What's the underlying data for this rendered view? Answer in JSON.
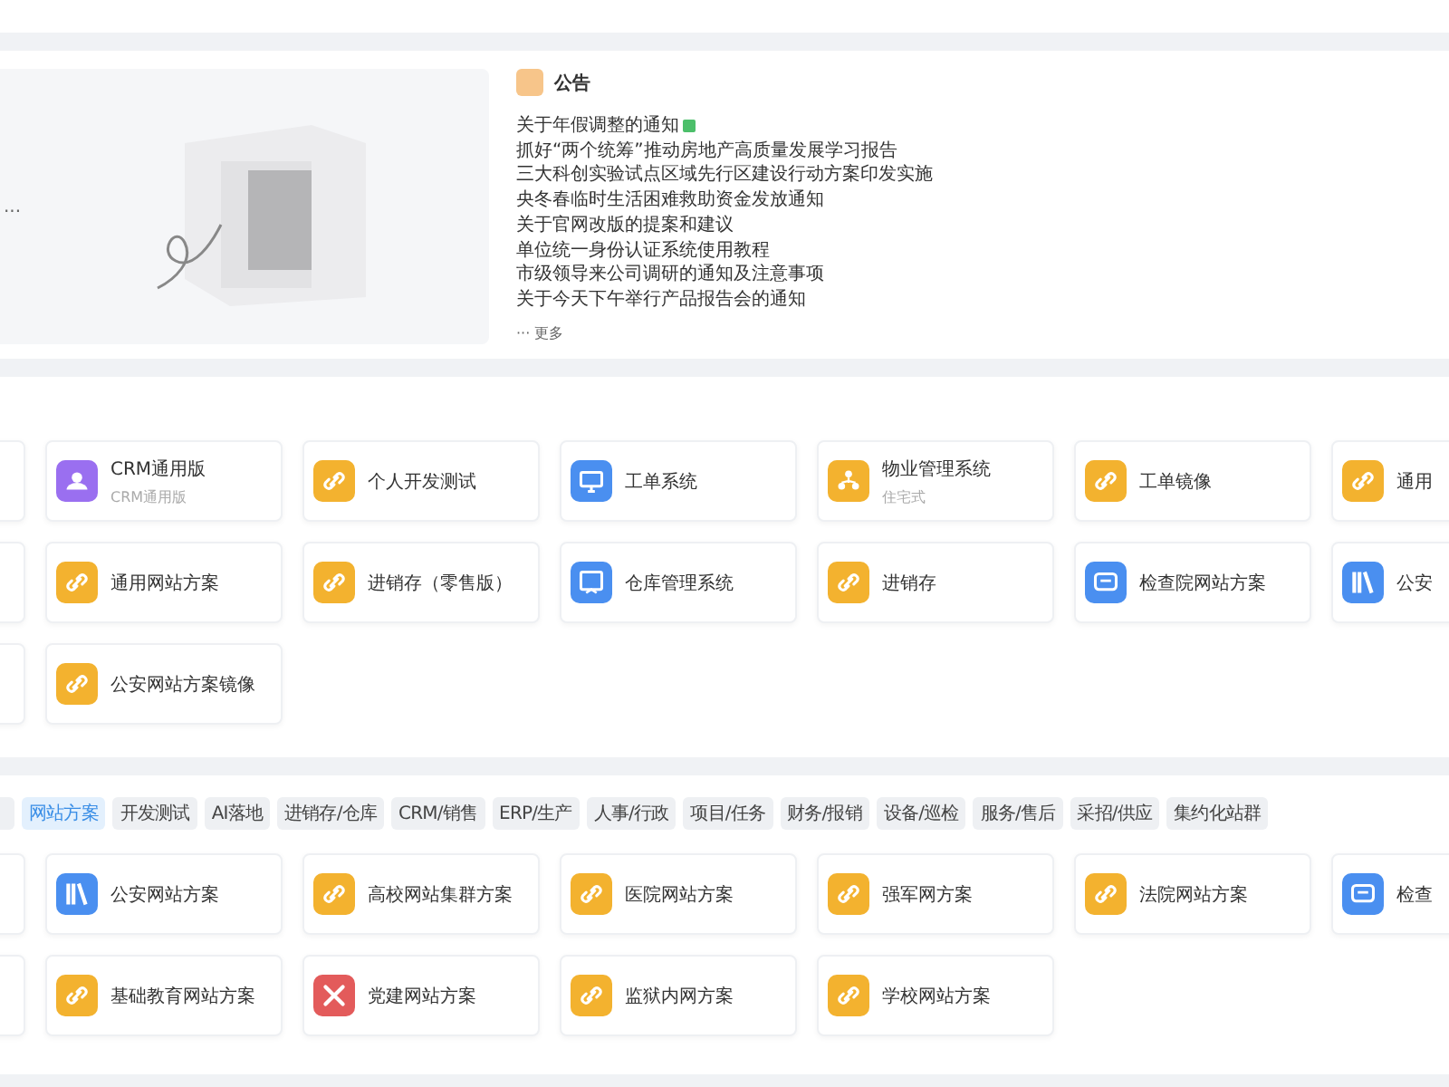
{
  "banner": {
    "hint": "..."
  },
  "notice": {
    "title": "公告",
    "items": [
      {
        "text": "关于年假调整的通知",
        "new": true
      },
      {
        "text": "抓好“两个统筹”推动房地产高质量发展学习报告",
        "new": false
      },
      {
        "text": "三大科创实验试点区域先行区建设行动方案印发实施",
        "new": false
      },
      {
        "text": "央冬春临时生活困难救助资金发放通知",
        "new": false
      },
      {
        "text": "关于官网改版的提案和建议",
        "new": false
      },
      {
        "text": "单位统一身份认证系统使用教程",
        "new": false
      },
      {
        "text": "市级领导来公司调研的通知及注意事项",
        "new": false
      },
      {
        "text": "关于今天下午举行产品报告会的通知",
        "new": false
      }
    ],
    "more": "··· 更多"
  },
  "apps": [
    [
      {
        "kind": "blank"
      },
      {
        "kind": "user",
        "title": "CRM通用版",
        "subtitle": "CRM通用版"
      },
      {
        "kind": "link",
        "title": "个人开发测试"
      },
      {
        "kind": "monitor",
        "title": "工单系统"
      },
      {
        "kind": "org",
        "title": "物业管理系统",
        "subtitle": "住宅式"
      },
      {
        "kind": "link",
        "title": "工单镜像"
      },
      {
        "kind": "link",
        "title": "通用"
      }
    ],
    [
      {
        "kind": "blank"
      },
      {
        "kind": "link",
        "title": "通用网站方案"
      },
      {
        "kind": "link",
        "title": "进销存（零售版）"
      },
      {
        "kind": "screen",
        "title": "仓库管理系统"
      },
      {
        "kind": "link",
        "title": "进销存"
      },
      {
        "kind": "chat",
        "title": "检查院网站方案"
      },
      {
        "kind": "books",
        "title": "公安"
      }
    ],
    [
      {
        "kind": "blank"
      },
      {
        "kind": "link",
        "title": "公安网站方案镜像"
      }
    ]
  ],
  "solutions": {
    "tabs": [
      {
        "label": "网站方案",
        "selected": true
      },
      {
        "label": "开发测试",
        "selected": false
      },
      {
        "label": "AI落地",
        "selected": false
      },
      {
        "label": "进销存/仓库",
        "selected": false
      },
      {
        "label": "CRM/销售",
        "selected": false
      },
      {
        "label": "ERP/生产",
        "selected": false
      },
      {
        "label": "人事/行政",
        "selected": false
      },
      {
        "label": "项目/任务",
        "selected": false
      },
      {
        "label": "财务/报销",
        "selected": false
      },
      {
        "label": "设备/巡检",
        "selected": false
      },
      {
        "label": "服务/售后",
        "selected": false
      },
      {
        "label": "采招/供应",
        "selected": false
      },
      {
        "label": "集约化站群",
        "selected": false
      }
    ],
    "cards": [
      [
        {
          "kind": "blank"
        },
        {
          "kind": "books",
          "title": "公安网站方案"
        },
        {
          "kind": "link",
          "title": "高校网站集群方案"
        },
        {
          "kind": "link",
          "title": "医院网站方案"
        },
        {
          "kind": "link",
          "title": "强军网方案"
        },
        {
          "kind": "link",
          "title": "法院网站方案"
        },
        {
          "kind": "chat",
          "title": "检查"
        }
      ],
      [
        {
          "kind": "blank"
        },
        {
          "kind": "link",
          "title": "基础教育网站方案"
        },
        {
          "kind": "tools",
          "title": "党建网站方案"
        },
        {
          "kind": "link",
          "title": "监狱内网方案"
        },
        {
          "kind": "link",
          "title": "学校网站方案"
        }
      ]
    ]
  }
}
